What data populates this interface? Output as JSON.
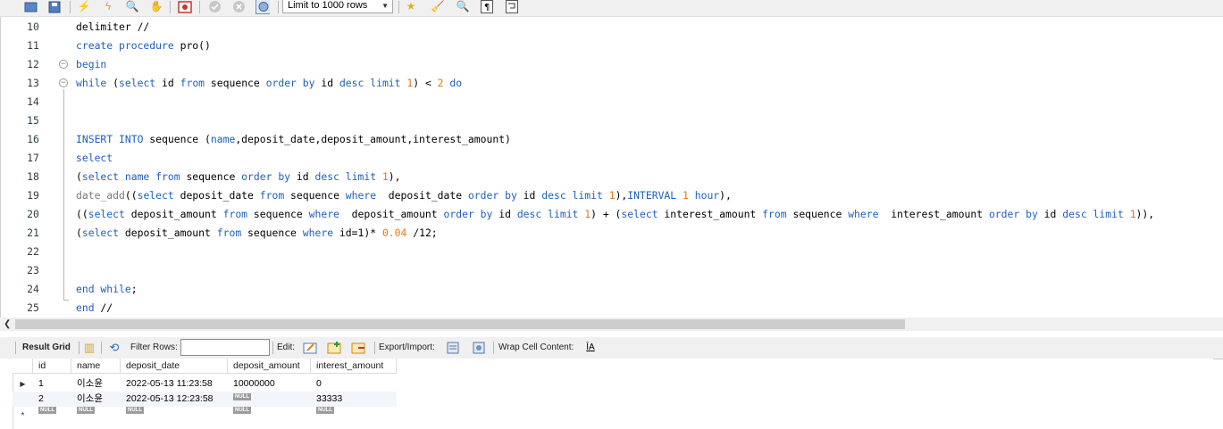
{
  "toolbar": {
    "limit_select": "Limit to 1000 rows",
    "icons": [
      "open-file-icon",
      "save-icon",
      "execute-icon",
      "execute-current-icon",
      "explain-icon",
      "stop-icon",
      "toggle-continue-icon",
      "commit-icon",
      "rollback-icon",
      "autocommit-icon",
      "beautify-icon",
      "find-icon",
      "invisible-chars-icon",
      "wrap-icon"
    ]
  },
  "editor": {
    "lines": [
      {
        "n": "10",
        "tokens": [
          [
            "t",
            "delimiter //"
          ]
        ]
      },
      {
        "n": "11",
        "tokens": [
          [
            "kw",
            "create procedure"
          ],
          [
            "t",
            " pro()"
          ]
        ]
      },
      {
        "n": "12",
        "tokens": [
          [
            "kw",
            "begin"
          ]
        ]
      },
      {
        "n": "13",
        "tokens": [
          [
            "kw",
            "while"
          ],
          [
            "t",
            " ("
          ],
          [
            "kw",
            "select"
          ],
          [
            "t",
            " id "
          ],
          [
            "kw",
            "from"
          ],
          [
            "t",
            " sequence "
          ],
          [
            "kw",
            "order by"
          ],
          [
            "t",
            " id "
          ],
          [
            "kw",
            "desc limit"
          ],
          [
            "t",
            " "
          ],
          [
            "num",
            "1"
          ],
          [
            "t",
            ") < "
          ],
          [
            "num",
            "2"
          ],
          [
            "t",
            " "
          ],
          [
            "kw",
            "do"
          ]
        ]
      },
      {
        "n": "14",
        "tokens": []
      },
      {
        "n": "15",
        "tokens": []
      },
      {
        "n": "16",
        "tokens": [
          [
            "kw",
            "INSERT INTO"
          ],
          [
            "t",
            " sequence ("
          ],
          [
            "kw",
            "name"
          ],
          [
            "t",
            ",deposit_date,deposit_amount,interest_amount)"
          ]
        ]
      },
      {
        "n": "17",
        "tokens": [
          [
            "kw",
            "select"
          ]
        ]
      },
      {
        "n": "18",
        "tokens": [
          [
            "t",
            "("
          ],
          [
            "kw",
            "select name from"
          ],
          [
            "t",
            " sequence "
          ],
          [
            "kw",
            "order by"
          ],
          [
            "t",
            " id "
          ],
          [
            "kw",
            "desc limit"
          ],
          [
            "t",
            " "
          ],
          [
            "num",
            "1"
          ],
          [
            "t",
            "),"
          ]
        ]
      },
      {
        "n": "19",
        "tokens": [
          [
            "fn",
            "date_add"
          ],
          [
            "t",
            "(("
          ],
          [
            "kw",
            "select"
          ],
          [
            "t",
            " deposit_date "
          ],
          [
            "kw",
            "from"
          ],
          [
            "t",
            " sequence "
          ],
          [
            "kw",
            "where"
          ],
          [
            "t",
            "  deposit_date "
          ],
          [
            "kw",
            "order by"
          ],
          [
            "t",
            " id "
          ],
          [
            "kw",
            "desc limit"
          ],
          [
            "t",
            " "
          ],
          [
            "num",
            "1"
          ],
          [
            "t",
            "),"
          ],
          [
            "kw",
            "INTERVAL"
          ],
          [
            "t",
            " "
          ],
          [
            "num",
            "1"
          ],
          [
            "t",
            " "
          ],
          [
            "kw",
            "hour"
          ],
          [
            "t",
            "),"
          ]
        ]
      },
      {
        "n": "20",
        "tokens": [
          [
            "t",
            "(("
          ],
          [
            "kw",
            "select"
          ],
          [
            "t",
            " deposit_amount "
          ],
          [
            "kw",
            "from"
          ],
          [
            "t",
            " sequence "
          ],
          [
            "kw",
            "where"
          ],
          [
            "t",
            "  deposit_amount "
          ],
          [
            "kw",
            "order by"
          ],
          [
            "t",
            " id "
          ],
          [
            "kw",
            "desc limit"
          ],
          [
            "t",
            " "
          ],
          [
            "num",
            "1"
          ],
          [
            "t",
            ") + ("
          ],
          [
            "kw",
            "select"
          ],
          [
            "t",
            " interest_amount "
          ],
          [
            "kw",
            "from"
          ],
          [
            "t",
            " sequence "
          ],
          [
            "kw",
            "where"
          ],
          [
            "t",
            "  interest_amount "
          ],
          [
            "kw",
            "order by"
          ],
          [
            "t",
            " id "
          ],
          [
            "kw",
            "desc limit"
          ],
          [
            "t",
            " "
          ],
          [
            "num",
            "1"
          ],
          [
            "t",
            ")),"
          ]
        ]
      },
      {
        "n": "21",
        "tokens": [
          [
            "t",
            "("
          ],
          [
            "kw",
            "select"
          ],
          [
            "t",
            " deposit_amount "
          ],
          [
            "kw",
            "from"
          ],
          [
            "t",
            " sequence "
          ],
          [
            "kw",
            "where"
          ],
          [
            "t",
            " id=1)* "
          ],
          [
            "num",
            "0.04"
          ],
          [
            "t",
            " /12;"
          ]
        ]
      },
      {
        "n": "22",
        "tokens": []
      },
      {
        "n": "23",
        "tokens": []
      },
      {
        "n": "24",
        "tokens": [
          [
            "kw",
            "end while"
          ],
          [
            "t",
            ";"
          ]
        ]
      },
      {
        "n": "25",
        "tokens": [
          [
            "kw",
            "end"
          ],
          [
            "t",
            " //"
          ]
        ]
      }
    ]
  },
  "result_toolbar": {
    "result_grid": "Result Grid",
    "filter_rows": "Filter Rows:",
    "filter_value": "",
    "edit": "Edit:",
    "export_import": "Export/Import:",
    "wrap_cell": "Wrap Cell Content:"
  },
  "grid": {
    "columns": [
      "id",
      "name",
      "deposit_date",
      "deposit_amount",
      "interest_amount"
    ],
    "null_label": "NULL",
    "rows": [
      {
        "marker": "▶",
        "cells": [
          "1",
          "이소윤",
          "2022-05-13 11:23:58",
          "10000000",
          "0"
        ]
      },
      {
        "marker": "",
        "cells": [
          "2",
          "이소윤",
          "2022-05-13 12:23:58",
          null,
          "33333"
        ]
      },
      {
        "marker": "*",
        "cells": [
          null,
          null,
          null,
          null,
          null
        ]
      }
    ]
  },
  "colors": {
    "keyword": "#1f5fbf",
    "number": "#e0781a",
    "function": "#7a7a7a"
  }
}
